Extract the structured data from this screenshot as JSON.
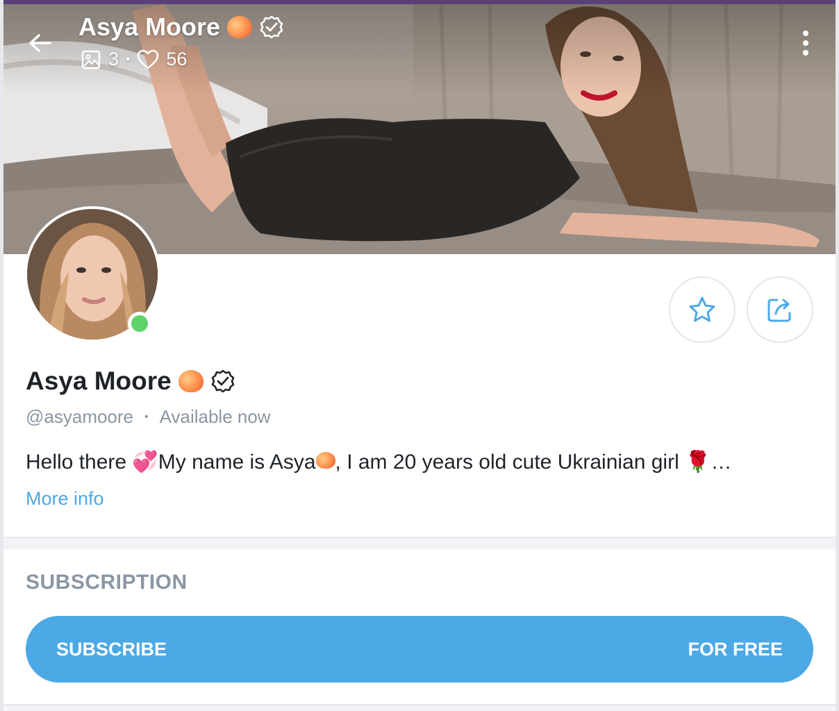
{
  "header": {
    "title": "Asya Moore",
    "stats": {
      "photos": "3",
      "likes": "56"
    }
  },
  "profile": {
    "name": "Asya Moore",
    "handle": "@asyamoore",
    "status": "Available now",
    "bio_part1": "Hello there ",
    "bio_part2": "My name is Asya",
    "bio_part3": ", I am 20 years old cute Ukrainian girl ",
    "bio_ellipsis": "…",
    "more_info": "More info"
  },
  "subscription": {
    "section_title": "SUBSCRIPTION",
    "button_left": "SUBSCRIBE",
    "button_right": "FOR FREE"
  },
  "icons": {
    "back": "arrow-left-icon",
    "photos": "image-icon",
    "likes": "heart-icon",
    "more": "more-vertical-icon",
    "star": "star-icon",
    "share": "share-icon",
    "verified": "verified-badge-icon"
  },
  "colors": {
    "accent": "#4ca9e6",
    "online": "#5fd36a",
    "muted_text": "#8a96a3",
    "top_bar": "#5a3f7a"
  }
}
